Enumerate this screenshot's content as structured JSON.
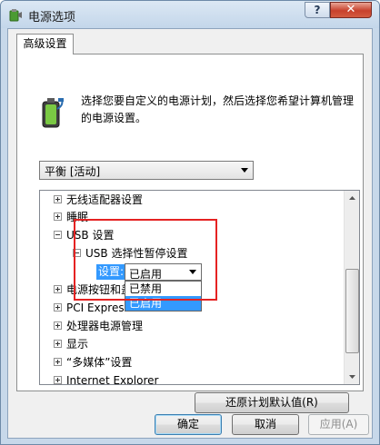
{
  "window": {
    "title": "电源选项",
    "help_label": "?",
    "close_label": "✕"
  },
  "tabs": [
    "高级设置"
  ],
  "description": "选择您要自定义的电源计划，然后选择您希望计算机管理的电源设置。",
  "plan_select": {
    "value": "平衡 [活动]"
  },
  "tree": {
    "items": [
      {
        "label": "无线适配器设置",
        "expander": "+"
      },
      {
        "label": "睡眠",
        "expander": "+"
      },
      {
        "label": "USB 设置",
        "expander": "-"
      },
      {
        "label": "USB 选择性暂停设置",
        "expander": "-"
      },
      {
        "label": "电源按钮和盖",
        "expander": "+"
      },
      {
        "label": "PCI Express",
        "expander": "+"
      },
      {
        "label": "处理器电源管理",
        "expander": "+"
      },
      {
        "label": "显示",
        "expander": "+"
      },
      {
        "label": "“多媒体”设置",
        "expander": "+"
      },
      {
        "label": "Internet Explorer",
        "expander": "+"
      }
    ],
    "setting_label": "设置:",
    "setting_value": "已启用",
    "dropdown_options": [
      "已禁用",
      "已启用"
    ],
    "selected_option": "已启用"
  },
  "restore_button": "还原计划默认值(R)",
  "footer": {
    "ok": "确定",
    "cancel": "取消",
    "apply": "应用(A)"
  },
  "colors": {
    "selection": "#3399ff",
    "annotation_box": "#e52222"
  }
}
